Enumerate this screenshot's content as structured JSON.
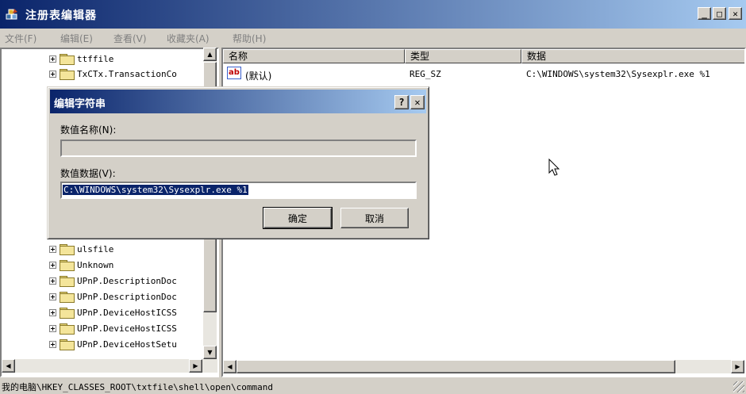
{
  "window": {
    "title": "注册表编辑器",
    "app_icon": "regedit-icon",
    "minimize_glyph": "_",
    "maximize_glyph": "□",
    "close_glyph": "✕"
  },
  "menu": [
    {
      "label": "文件(F)"
    },
    {
      "label": "编辑(E)"
    },
    {
      "label": "查看(V)"
    },
    {
      "label": "收藏夹(A)"
    },
    {
      "label": "帮助(H)"
    }
  ],
  "tree": {
    "items_top": [
      {
        "label": "ttffile"
      },
      {
        "label": "TxCTx.TransactionCo"
      }
    ],
    "items_bottom": [
      {
        "label": "ulsfile"
      },
      {
        "label": "Unknown"
      },
      {
        "label": "UPnP.DescriptionDoc"
      },
      {
        "label": "UPnP.DescriptionDoc"
      },
      {
        "label": "UPnP.DeviceHostICSS"
      },
      {
        "label": "UPnP.DeviceHostICSS"
      },
      {
        "label": "UPnP.DeviceHostSetu"
      }
    ]
  },
  "listview": {
    "columns": [
      {
        "label": "名称"
      },
      {
        "label": "类型"
      },
      {
        "label": "数据"
      }
    ],
    "rows": [
      {
        "name": "(默认)",
        "type": "REG_SZ",
        "data": "C:\\WINDOWS\\system32\\Sysexplr.exe %1",
        "icon": "string-value-icon"
      }
    ]
  },
  "dialog": {
    "title": "编辑字符串",
    "help_glyph": "?",
    "close_glyph": "✕",
    "name_label": "数值名称(N):",
    "name_value": "",
    "data_label": "数值数据(V):",
    "data_value": "C:\\WINDOWS\\system32\\Sysexplr.exe %1",
    "ok_label": "确定",
    "cancel_label": "取消"
  },
  "status": {
    "path": "我的电脑\\HKEY_CLASSES_ROOT\\txtfile\\shell\\open\\command"
  }
}
